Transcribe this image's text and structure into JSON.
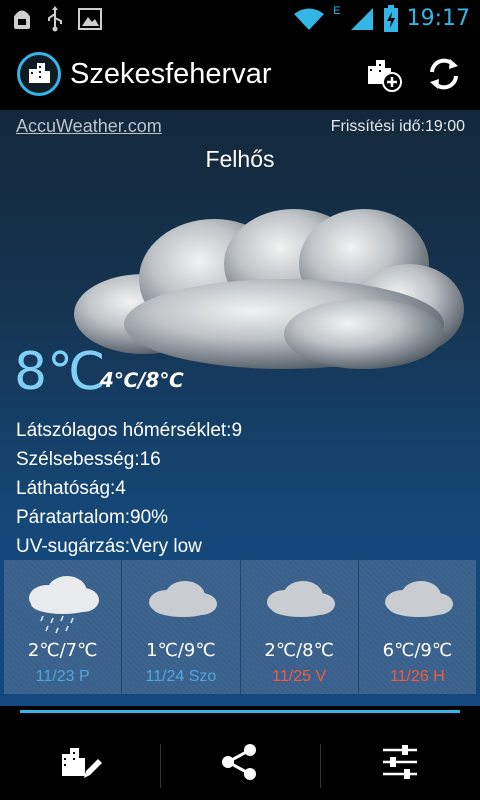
{
  "status_bar": {
    "time": "19:17",
    "network_label": "E",
    "left_icons": [
      "android-debug-icon",
      "usb-icon",
      "image-icon"
    ],
    "right_icons": [
      "wifi-icon",
      "signal-icon",
      "battery-charging-icon"
    ]
  },
  "action_bar": {
    "title": "Szekesfehervar",
    "icons": [
      "city-icon",
      "add-city-icon",
      "refresh-icon"
    ]
  },
  "weather": {
    "provider": "AccuWeather.com",
    "updated": "Frissítési idő:19:00",
    "condition": "Felhős",
    "temperature": "8℃",
    "low": "4℃",
    "high": "8℃",
    "separator": "/",
    "details": [
      "Látszólagos hőmérséklet:9",
      "Szélsebesség:16",
      "Láthatóság:4",
      "Páratartalom:90%",
      "UV-sugárzás:Very low"
    ]
  },
  "forecast": [
    {
      "temp": "2℃/7℃",
      "date": "11/23 P",
      "icon": "rain-cloud-icon",
      "date_color": "#4ea6e0"
    },
    {
      "temp": "1℃/9℃",
      "date": "11/24 Szo",
      "icon": "cloud-icon",
      "date_color": "#4ea6e0"
    },
    {
      "temp": "2℃/8℃",
      "date": "11/25 V",
      "icon": "cloud-icon",
      "date_color": "#f05a3c"
    },
    {
      "temp": "6℃/9℃",
      "date": "11/26 H",
      "icon": "cloud-icon",
      "date_color": "#f05a3c"
    }
  ],
  "colors": {
    "accent": "#33b5e5",
    "temperature": "#7fd0f4",
    "weekday_date": "#4ea6e0",
    "weekend_date": "#f05a3c"
  },
  "bottom_bar": {
    "buttons": [
      "edit-city-icon",
      "share-icon",
      "settings-sliders-icon"
    ]
  }
}
